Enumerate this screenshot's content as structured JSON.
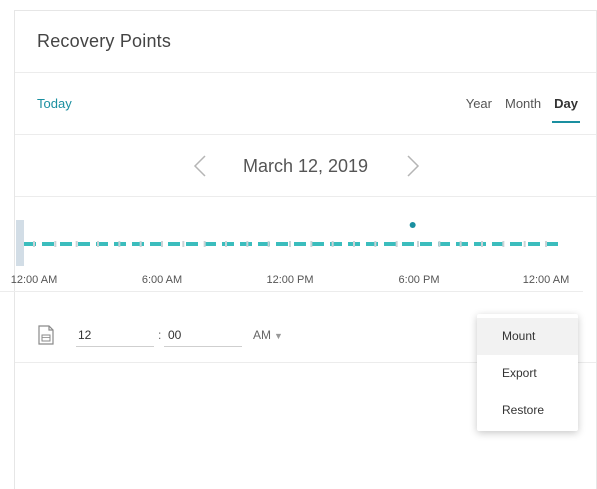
{
  "header": {
    "title": "Recovery Points"
  },
  "range_bar": {
    "today_label": "Today",
    "ranges": [
      {
        "label": "Year",
        "active": false
      },
      {
        "label": "Month",
        "active": false
      },
      {
        "label": "Day",
        "active": true
      }
    ]
  },
  "date_nav": {
    "date": "March 12, 2019",
    "prev_icon": "chevron-left-icon",
    "next_icon": "chevron-right-icon"
  },
  "timeline": {
    "tick_labels": [
      "12:00 AM",
      "6:00 AM",
      "12:00 PM",
      "6:00 PM",
      "12:00 AM"
    ],
    "accent_color": "#3bbdbd",
    "recovery_point_time": "5:45 PM"
  },
  "time_picker": {
    "icon": "file-calendar-icon",
    "hour": "12",
    "separator": ":",
    "minute": "00",
    "ampm": "AM",
    "ampm_caret": "▼"
  },
  "context_menu": {
    "items": [
      {
        "label": "Mount",
        "hover": true
      },
      {
        "label": "Export",
        "hover": false
      },
      {
        "label": "Restore",
        "hover": false
      }
    ]
  },
  "colors": {
    "accent": "#1a8fa0",
    "timeline": "#3bbdbd"
  }
}
